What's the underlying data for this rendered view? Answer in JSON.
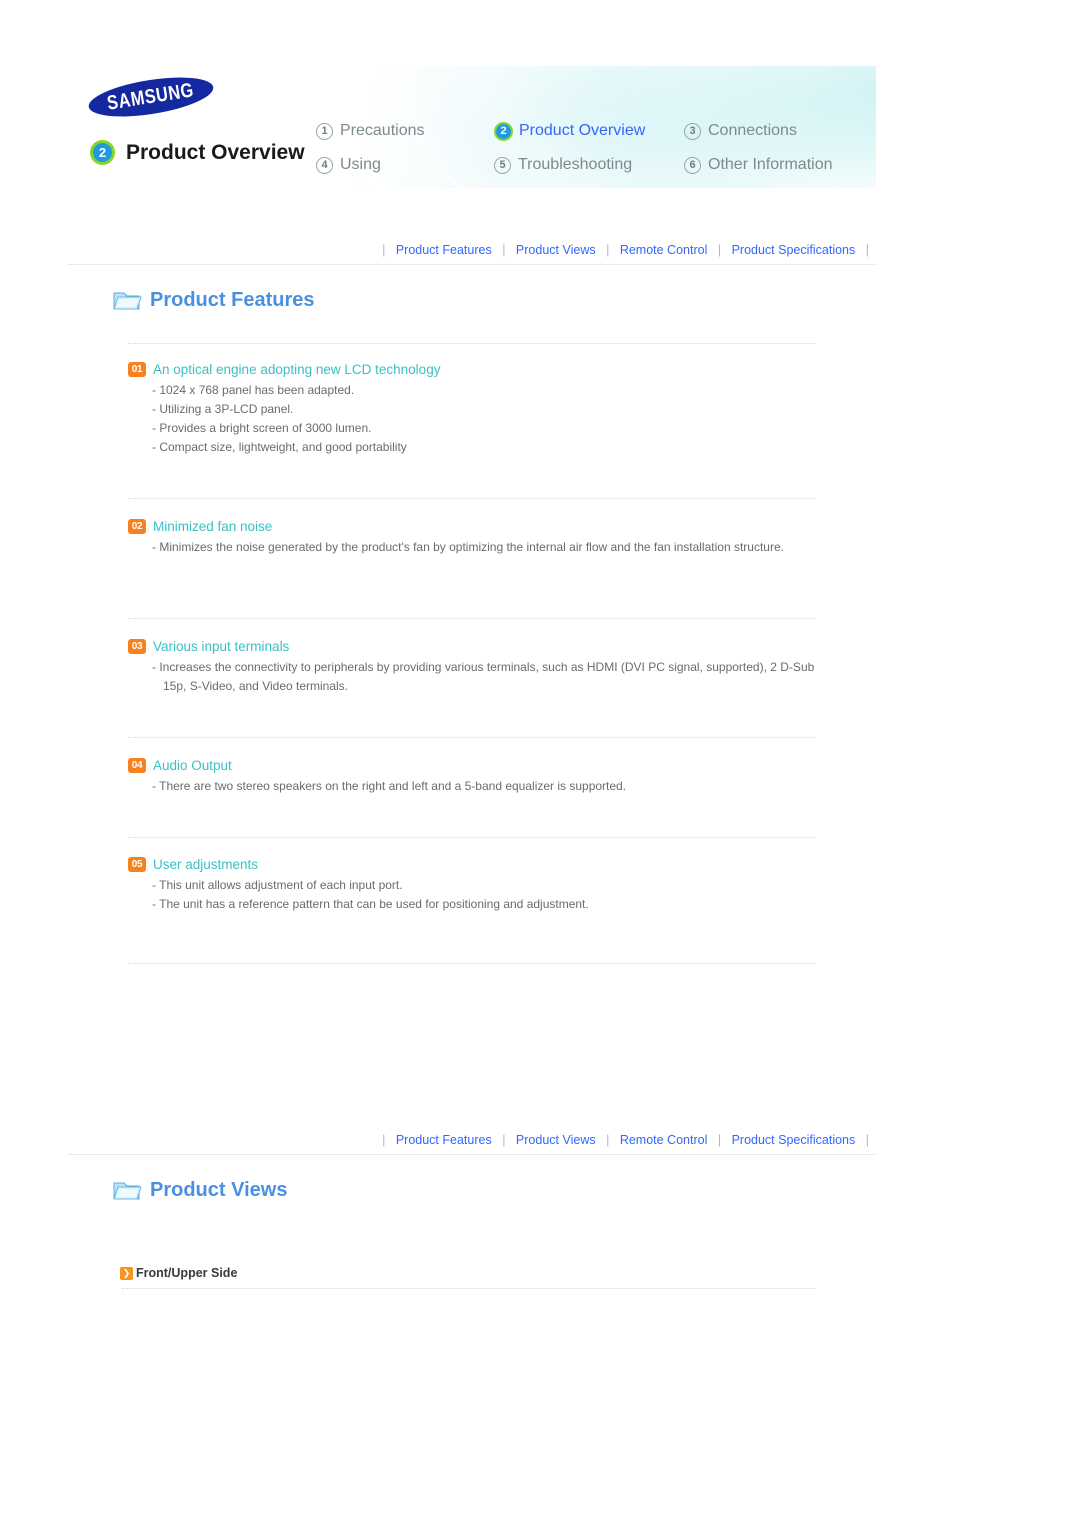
{
  "header": {
    "brand": "SAMSUNG",
    "page_number": "2",
    "page_title": "Product Overview",
    "nav_items": [
      {
        "num": "1",
        "label": "Precautions",
        "active": false
      },
      {
        "num": "2",
        "label": "Product Overview",
        "active": true
      },
      {
        "num": "3",
        "label": "Connections",
        "active": false
      },
      {
        "num": "4",
        "label": "Using",
        "active": false
      },
      {
        "num": "5",
        "label": "Troubleshooting",
        "active": false
      },
      {
        "num": "6",
        "label": "Other Information",
        "active": false
      }
    ]
  },
  "tabbar": {
    "items": [
      "Product Features",
      "Product Views",
      "Remote Control",
      "Product Specifications"
    ],
    "separator": "|"
  },
  "sections": {
    "product_features": {
      "title": "Product Features",
      "icon": "folder-icon"
    },
    "product_views": {
      "title": "Product Views",
      "icon": "folder-icon",
      "subhead": "Front/Upper Side",
      "subhead_icon": "chevron-right-icon"
    }
  },
  "features": [
    {
      "num": "01",
      "title": "An optical engine adopting new LCD technology",
      "bullets": [
        "- 1024 x 768 panel has been adapted.",
        "- Utilizing a 3P-LCD panel.",
        "- Provides a bright screen of 3000 lumen.",
        "- Compact size, lightweight, and good portability"
      ]
    },
    {
      "num": "02",
      "title": "Minimized fan noise",
      "bullets": [
        "- Minimizes the noise generated by the product's fan by optimizing the internal air flow and the fan installation structure."
      ]
    },
    {
      "num": "03",
      "title": "Various input terminals",
      "bullets": [
        "- Increases the connectivity to peripherals by providing various terminals, such as HDMI (DVI PC signal, supported), 2 D-Sub 15p, S-Video, and Video terminals."
      ]
    },
    {
      "num": "04",
      "title": "Audio Output",
      "bullets": [
        "- There are two stereo speakers on the right and left and a 5-band equalizer is supported."
      ]
    },
    {
      "num": "05",
      "title": "User adjustments",
      "bullets": [
        "- This unit allows adjustment of each input port.",
        "- The unit has a reference pattern that can be used for positioning and adjustment."
      ]
    }
  ],
  "colors": {
    "brand_blue": "#1428a0",
    "accent_orange": "#f5821f",
    "heading_teal": "#3bc0c4",
    "link_blue": "#3366ff",
    "section_blue": "#4a90e2",
    "green_ring": "#86d628"
  }
}
